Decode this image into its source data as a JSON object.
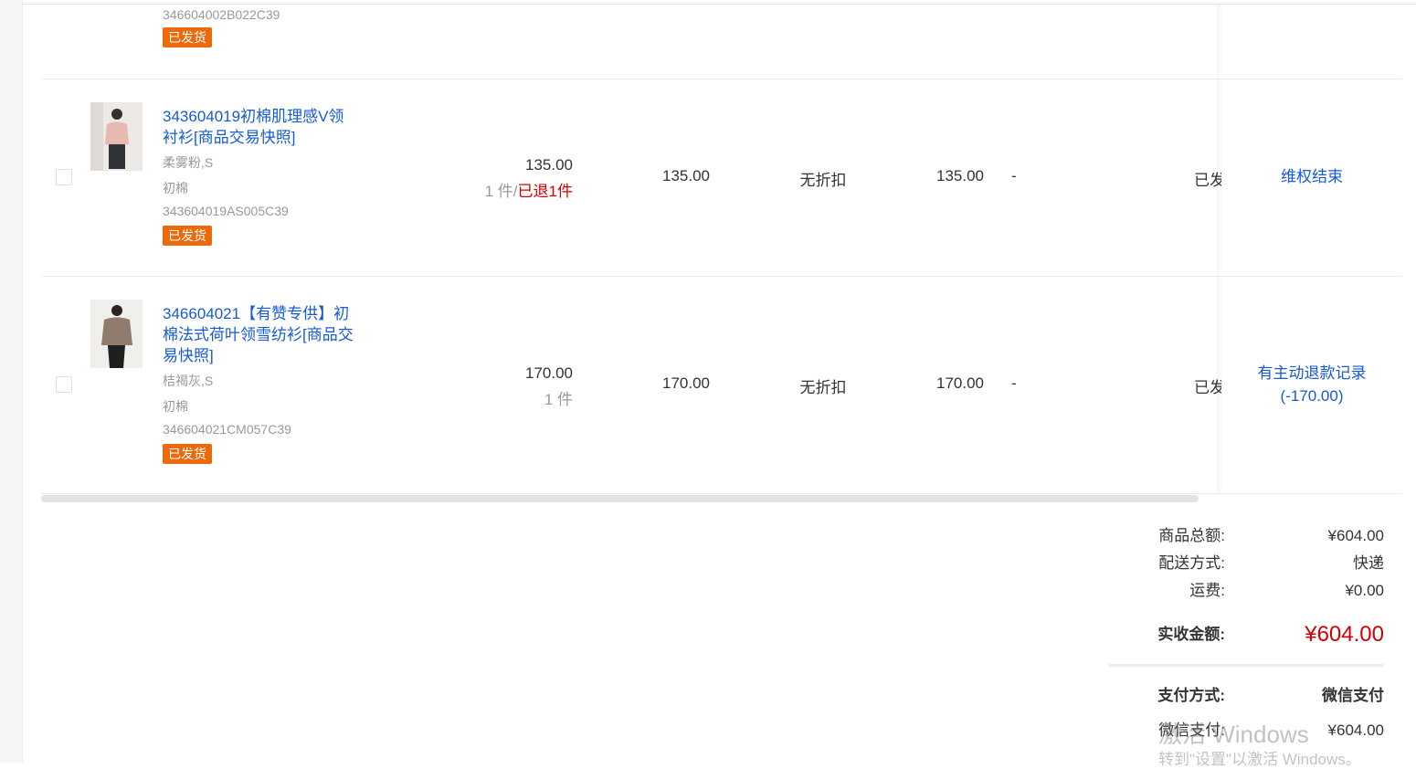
{
  "first_row": {
    "code": "346604002B022C39",
    "tag": "已发货"
  },
  "items": [
    {
      "title": "343604019初棉肌理感V领衬衫[商品交易快照]",
      "spec": "柔雾粉,S",
      "brand": "初棉",
      "code": "343604019AS005C39",
      "tag": "已发货",
      "unit_price": "135.00",
      "qty_label": "1 件/",
      "refund_label": "已退1件",
      "subtotal": "135.00",
      "discount": "无折扣",
      "paid": "135.00",
      "dash": "-",
      "status_partial": "已发",
      "action_line1": "维权结束",
      "action_line2": ""
    },
    {
      "title": "346604021【有赞专供】初棉法式荷叶领雪纺衫[商品交易快照]",
      "spec": "桔褐灰,S",
      "brand": "初棉",
      "code": "346604021CM057C39",
      "tag": "已发货",
      "unit_price": "170.00",
      "qty_label": "1 件",
      "refund_label": "",
      "subtotal": "170.00",
      "discount": "无折扣",
      "paid": "170.00",
      "dash": "-",
      "status_partial": "已发",
      "action_line1": "有主动退款记录",
      "action_line2": "(-170.00)"
    }
  ],
  "summary": {
    "goods_total_label": "商品总额:",
    "goods_total_value": "¥604.00",
    "delivery_label": "配送方式:",
    "delivery_value": "快递",
    "freight_label": "运费:",
    "freight_value": "¥0.00",
    "received_label": "实收金额:",
    "received_value": "¥604.00",
    "payment_method_label": "支付方式:",
    "payment_method_value": "微信支付",
    "wechat_pay_label": "微信支付:",
    "wechat_pay_value": "¥604.00"
  },
  "watermark": {
    "line1": "激活 Windows",
    "line2": "转到\"设置\"以激活 Windows。"
  },
  "colors": {
    "link": "#155bd4",
    "tag_bg": "#ed6a0c",
    "red": "#d40000"
  }
}
